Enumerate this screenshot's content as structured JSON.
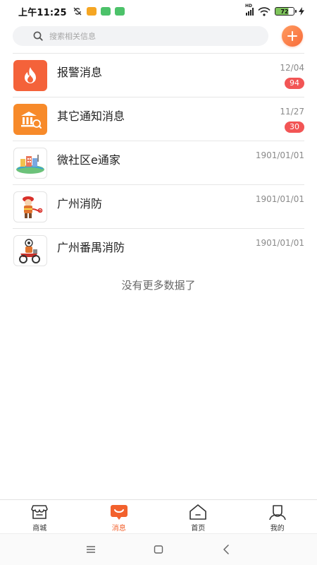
{
  "status_bar": {
    "time": "上午11:25",
    "network": "HD",
    "battery": "72"
  },
  "search": {
    "placeholder": "搜索相关信息"
  },
  "messages": [
    {
      "title": "报警消息",
      "date": "12/04",
      "badge": "94",
      "icon": "fire-icon",
      "color": "#f4623a"
    },
    {
      "title": "其它通知消息",
      "date": "11/27",
      "badge": "30",
      "icon": "bank-notice-icon",
      "color": "#f78a2a"
    },
    {
      "title": "微社区e通家",
      "date": "1901/01/01",
      "icon": "community-icon"
    },
    {
      "title": "广州消防",
      "date": "1901/01/01",
      "icon": "firefighter-icon"
    },
    {
      "title": "广州番禺消防",
      "date": "1901/01/01",
      "icon": "firefighter-bike-icon"
    }
  ],
  "footer_text": "没有更多数据了",
  "bottom_nav": [
    {
      "label": "商城",
      "icon": "store-icon",
      "active": false
    },
    {
      "label": "消息",
      "icon": "message-icon",
      "active": true
    },
    {
      "label": "首页",
      "icon": "home-icon",
      "active": false
    },
    {
      "label": "我的",
      "icon": "profile-icon",
      "active": false
    }
  ],
  "colors": {
    "accent": "#f2612d",
    "badge": "#f25555",
    "divider": "#e6e6e6"
  }
}
